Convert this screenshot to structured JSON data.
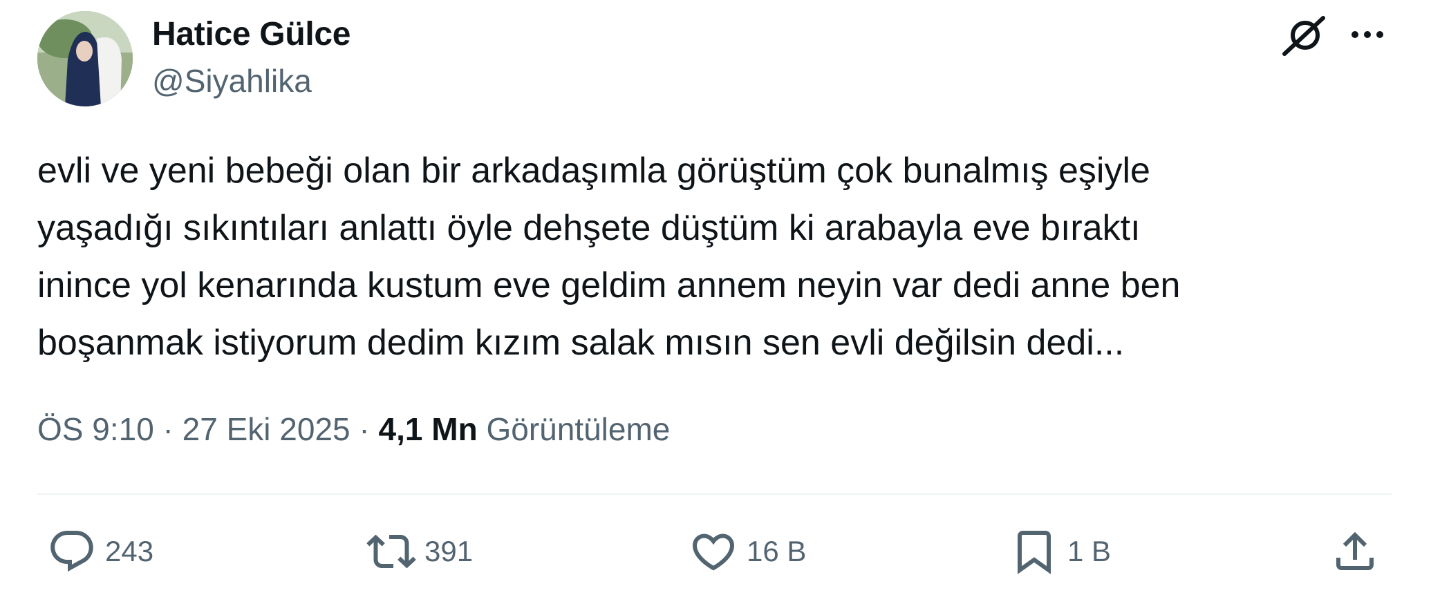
{
  "author": {
    "display_name": "Hatice Gülce",
    "handle": "@Siyahlika",
    "avatar_icon": "profile-photo"
  },
  "tweet": {
    "lines": [
      "evli ve yeni bebeği olan bir arkadaşımla görüştüm çok bunalmış eşiyle",
      "yaşadığı sıkıntıları anlattı öyle dehşete düştüm ki arabayla eve bıraktı",
      "inince yol kenarında kustum eve geldim annem neyin var dedi anne ben",
      "boşanmak istiyorum dedim kızım salak mısın sen evli değilsin dedi..."
    ]
  },
  "meta": {
    "time": "ÖS 9:10",
    "sep1": " · ",
    "date": "27 Eki 2025",
    "sep2": " · ",
    "views_count": "4,1 Mn",
    "views_label": " Görüntüleme"
  },
  "actions": {
    "replies": "243",
    "retweets": "391",
    "likes": "16 B",
    "bookmarks": "1 B"
  },
  "icons": {
    "top_right": [
      "grok-icon",
      "more-options-icon"
    ],
    "action_bar": [
      "reply-icon",
      "retweet-icon",
      "like-icon",
      "bookmark-icon",
      "share-icon"
    ]
  },
  "colors": {
    "text_primary": "#0f1419",
    "text_secondary": "#536471",
    "divider": "#eff3f4"
  }
}
